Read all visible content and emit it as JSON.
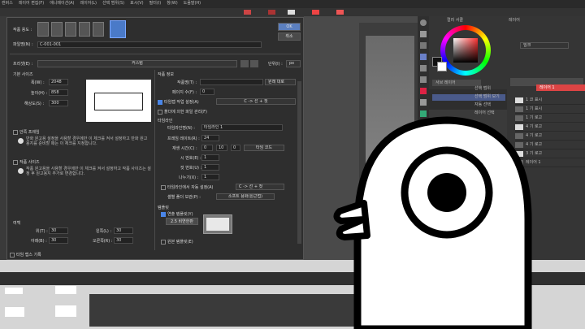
{
  "app": {
    "menu": [
      "캔버스",
      "레이어 편집(F)",
      "애니메이션(A)",
      "레이어(L)",
      "선택 범위(S)",
      "표시(V)",
      "필터(I)",
      "창(W)",
      "도움말(H)"
    ]
  },
  "dialog": {
    "title": "작품 용도 :",
    "ok_label": "OK",
    "cancel_label": "취소",
    "file_name_label": "파일명(N) :",
    "file_name_value": "C-001-001",
    "preset_label": "프리셋(E) :",
    "preset_value": "커스텀",
    "unit_label": "단위(I) :",
    "unit_value": "px",
    "base_size_title": "기본 사이즈",
    "width_label": "폭(W) :",
    "width_value": "2048",
    "height_label": "높이(H) :",
    "height_value": "858",
    "resolution_label": "해상도(S) :",
    "resolution_value": "300",
    "bleed_title": "안쪽 프레임",
    "bleed_note": "만화 원고용 설정을 사용할 경우에만 이 체크를 켜서 설정하고 만화 원고용지를 준비할 때는 이 체크를 지정합니다.",
    "scale_title": "작품 사이즈",
    "scale_note": "작품 원고용을 사용할 경우에만 이 체크를 켜서 설정하고 작품 사이즈는 설정 후 원고용지 추가로 변경합니다.",
    "margin_title": "여백",
    "margin_top_label": "위(T) :",
    "margin_top_value": "30",
    "margin_bottom_label": "아래(B) :",
    "margin_bottom_value": "30",
    "margin_left_label": "왼쪽(L) :",
    "margin_left_value": "30",
    "margin_right_label": "오른쪽(R) :",
    "margin_right_value": "30",
    "footer_check_label": "타임 랩스 기록",
    "work_info_title": "작품 정보",
    "work_title_label": "작품명(T) :",
    "work_title_select": "원래 대로",
    "episode_label": "페이지 수(F) :",
    "episode_value": "0",
    "dir_check_label": "타임랩 작업 설정(A)",
    "dir_check_select": "C -> 선 + 컷",
    "keep_check_label": "폴더에 의한 파일 관리(F)",
    "timeline_title": "타임라인",
    "timeline_name_label": "타임라인명(N) :",
    "timeline_name_value": "타임라인 1",
    "frame_rate_label": "프레임 레이트(R) :",
    "frame_rate_value": "24",
    "play_time_label": "재생 시간(C) :",
    "play_time_a": "0",
    "play_time_b": "10",
    "play_time_c": "0",
    "play_time_select": "타임 코드",
    "hour_label": "시 번호(E) :",
    "hour_value": "1",
    "minute_label": "컷 번호(U) :",
    "minute_value": "1",
    "length_label": "나누기(X) :",
    "length_value": "1",
    "auto_check_label": "타임라인에서 자동 설정(A)",
    "auto_check_select": "C -> 선 + 컷",
    "layer_folder_label": "셀별 폴더 보관(P) :",
    "layer_folder_select": "소프트 용화(원근법)",
    "template_title": "템플릿",
    "template_check_label": "연출 템플릿(Y)",
    "template_button": "2.5 비연한판",
    "storyboard_check_label": "원본 템플릿(E)"
  },
  "right_panel": {
    "color_title": "컬러 서클",
    "brush_name": "잉크",
    "sub_label": "서브 레이어",
    "layer_header": "레이어",
    "layer_name_top": "레이어 1",
    "layers": [
      "1 코 표시",
      "1 기 표시",
      "1 기 로고",
      "4 기 로고",
      "4 기 로고",
      "4 기 로고",
      "3 기 로고",
      "레이어 1"
    ],
    "tool_items": [
      "선택 범위",
      "선택 범위 보기",
      "자동 선택",
      "레이어 선택"
    ]
  }
}
